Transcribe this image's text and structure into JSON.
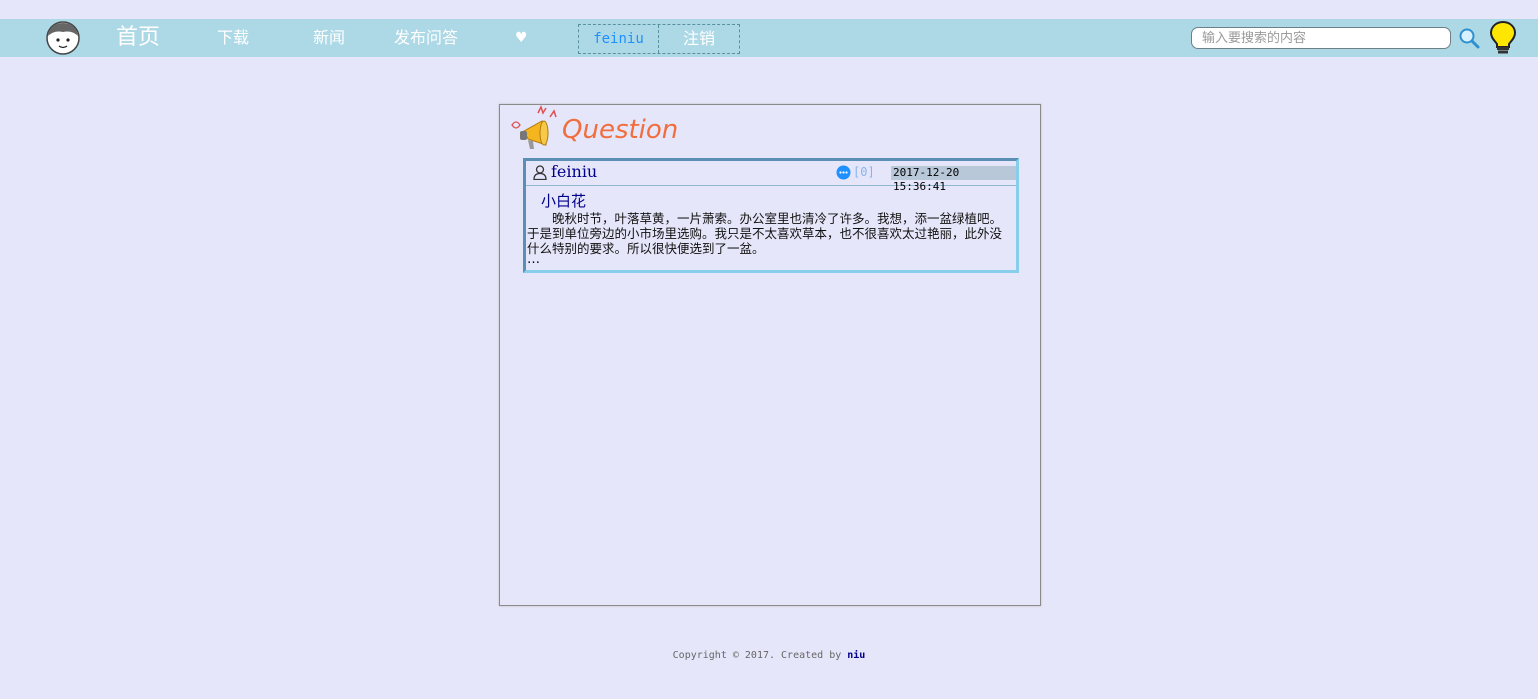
{
  "nav": {
    "home": "首页",
    "download": "下载",
    "news": "新闻",
    "ask": "发布问答",
    "heart": "♥",
    "username": "feiniu",
    "logout": "注销"
  },
  "search": {
    "placeholder": "输入要搜索的内容"
  },
  "panel": {
    "title": "Question"
  },
  "question": {
    "user": "feiniu",
    "comment_count": "[0]",
    "date": "2017-12-20 15:36:41",
    "title": "小白花",
    "body": "晚秋时节，叶落草黄，一片萧索。办公室里也清冷了许多。我想，添一盆绿植吧。于是到单位旁边的小市场里选购。我只是不太喜欢草本，也不很喜欢太过艳丽，此外没什么特别的要求。所以很快便选到了一盆。",
    "ellipsis": "…"
  },
  "footer": {
    "copyright": "Copyright © 2017. Created by",
    "author": "niu"
  },
  "colors": {
    "page_bg": "#e6e6fa",
    "topbar_bg": "#add8e6",
    "accent_title": "#f26d3d",
    "link_blue": "#00008b"
  },
  "icons": [
    "avatar-icon",
    "heart-icon",
    "search-icon",
    "lightbulb-icon",
    "megaphone-icon",
    "user-icon",
    "comment-icon"
  ]
}
